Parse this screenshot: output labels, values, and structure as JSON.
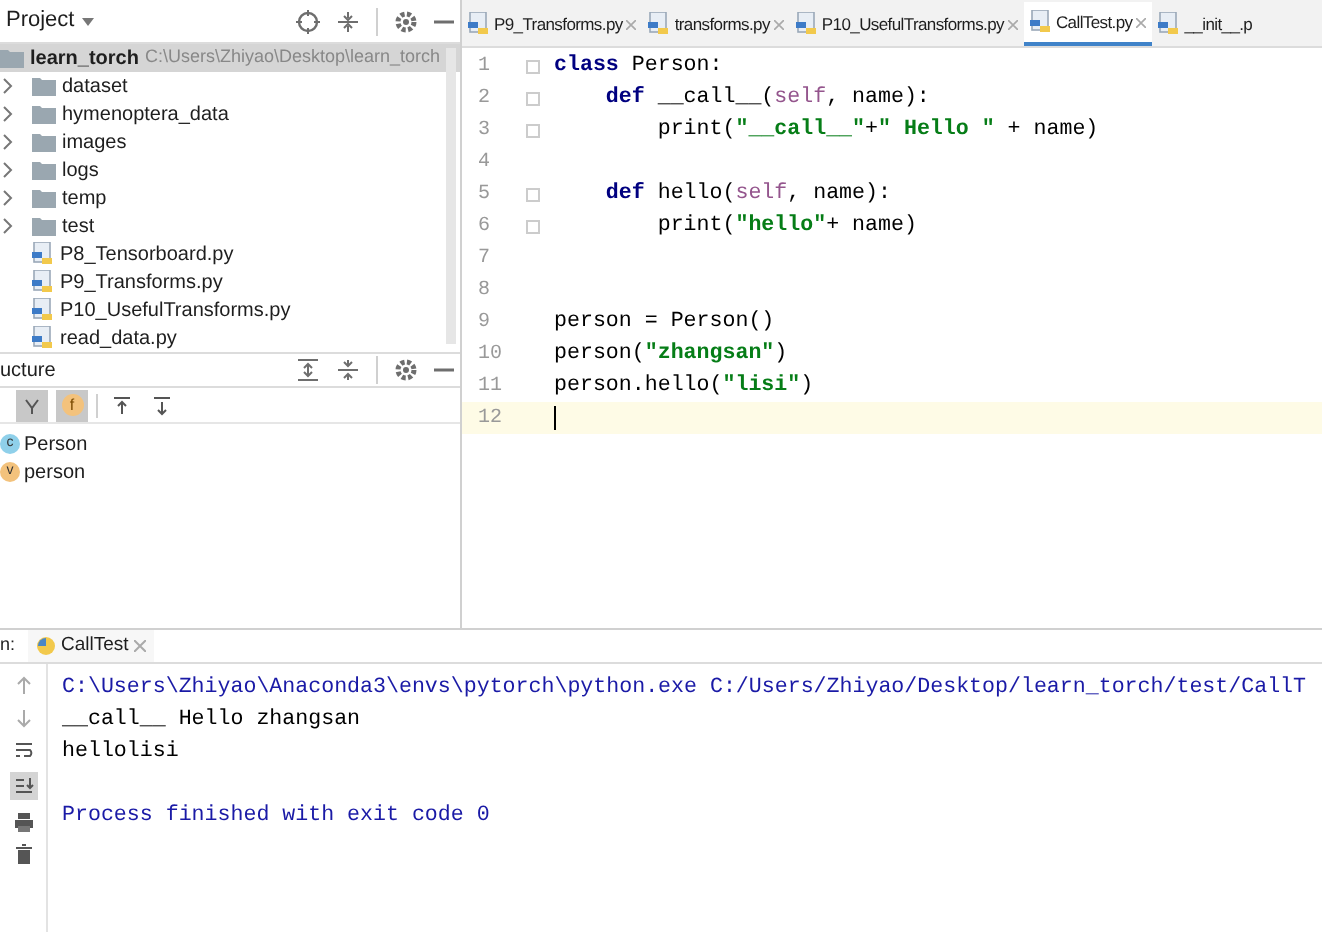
{
  "project_panel": {
    "title": "Project",
    "tree": [
      {
        "label": "learn_torch",
        "path": "C:\\Users\\Zhiyao\\Desktop\\learn_torch",
        "kind": "folder",
        "selected": true,
        "children": [
          {
            "label": "dataset",
            "kind": "folder",
            "expanded": false
          },
          {
            "label": "hymenoptera_data",
            "kind": "folder",
            "expanded": false
          },
          {
            "label": "images",
            "kind": "folder",
            "expanded": false
          },
          {
            "label": "logs",
            "kind": "folder",
            "expanded": false
          },
          {
            "label": "temp",
            "kind": "folder",
            "expanded": false
          },
          {
            "label": "test",
            "kind": "folder",
            "expanded": false
          },
          {
            "label": "P8_Tensorboard.py",
            "kind": "file"
          },
          {
            "label": "P9_Transforms.py",
            "kind": "file"
          },
          {
            "label": "P10_UsefulTransforms.py",
            "kind": "file"
          },
          {
            "label": "read_data.py",
            "kind": "file"
          }
        ]
      }
    ]
  },
  "structure_panel": {
    "title": "ucture",
    "toolbar": [
      {
        "kind": "sort",
        "on": true
      },
      {
        "kind": "fields",
        "label": "f",
        "on": true
      },
      {
        "kind": "expand",
        "on": false
      },
      {
        "kind": "collapse",
        "on": false
      }
    ],
    "items": [
      {
        "label": "Person",
        "badge": "c",
        "color": "#8fd0ea"
      },
      {
        "label": "person",
        "badge": "v",
        "color": "#f3c27c"
      }
    ]
  },
  "editor": {
    "tabs": [
      {
        "label": "P9_Transforms.py",
        "selected": false
      },
      {
        "label": "transforms.py",
        "selected": false
      },
      {
        "label": "P10_UsefulTransforms.py",
        "selected": false
      },
      {
        "label": "CallTest.py",
        "selected": true
      },
      {
        "label": "__init__.p",
        "selected": false
      }
    ],
    "lines": [
      {
        "number": "1",
        "fold": true,
        "current": false,
        "tokens": [
          {
            "text": "class",
            "kind": "keyword"
          },
          {
            "text": " Person:",
            "kind": "plain"
          }
        ]
      },
      {
        "number": "2",
        "fold": true,
        "current": false,
        "tokens": [
          {
            "text": "    def",
            "kind": "keyword"
          },
          {
            "text": " __call__(",
            "kind": "plain"
          },
          {
            "text": "self",
            "kind": "param"
          },
          {
            "text": ", name):",
            "kind": "plain"
          }
        ]
      },
      {
        "number": "3",
        "fold": true,
        "current": false,
        "tokens": [
          {
            "text": "        print(",
            "kind": "plain"
          },
          {
            "text": "\"__call__\"",
            "kind": "string"
          },
          {
            "text": "+",
            "kind": "plain"
          },
          {
            "text": "\" Hello \"",
            "kind": "string"
          },
          {
            "text": " + name)",
            "kind": "plain"
          }
        ]
      },
      {
        "number": "4",
        "fold": false,
        "current": false
      },
      {
        "number": "5",
        "fold": true,
        "current": false,
        "tokens": [
          {
            "text": "    def",
            "kind": "keyword"
          },
          {
            "text": " hello(",
            "kind": "plain"
          },
          {
            "text": "self",
            "kind": "param"
          },
          {
            "text": ", name):",
            "kind": "plain"
          }
        ]
      },
      {
        "number": "6",
        "fold": true,
        "current": false,
        "tokens": [
          {
            "text": "        print(",
            "kind": "plain"
          },
          {
            "text": "\"hello\"",
            "kind": "string"
          },
          {
            "text": "+ name)",
            "kind": "plain"
          }
        ]
      },
      {
        "number": "7",
        "fold": false,
        "current": false
      },
      {
        "number": "8",
        "fold": false,
        "current": false
      },
      {
        "number": "9",
        "fold": false,
        "current": false,
        "tokens": [
          {
            "text": "person = Person()",
            "kind": "plain"
          }
        ]
      },
      {
        "number": "10",
        "fold": false,
        "current": false,
        "tokens": [
          {
            "text": "person(",
            "kind": "plain"
          },
          {
            "text": "\"zhangsan\"",
            "kind": "string"
          },
          {
            "text": ")",
            "kind": "plain"
          }
        ]
      },
      {
        "number": "11",
        "fold": false,
        "current": false,
        "tokens": [
          {
            "text": "person.hello(",
            "kind": "plain"
          },
          {
            "text": "\"lisi\"",
            "kind": "string"
          },
          {
            "text": ")",
            "kind": "plain"
          }
        ]
      },
      {
        "number": "12",
        "fold": false,
        "current": true
      }
    ]
  },
  "run_panel": {
    "label": "n:",
    "tab": "CallTest",
    "lines": [
      {
        "text": "C:\\Users\\Zhiyao\\Anaconda3\\envs\\pytorch\\python.exe C:/Users/Zhiyao/Desktop/learn_torch/test/CallT",
        "kind": "command"
      },
      {
        "text": "__call__ Hello zhangsan",
        "kind": "output"
      },
      {
        "text": "hellolisi",
        "kind": "output"
      },
      {
        "text": "Process finished with exit code 0",
        "kind": "info"
      }
    ]
  }
}
